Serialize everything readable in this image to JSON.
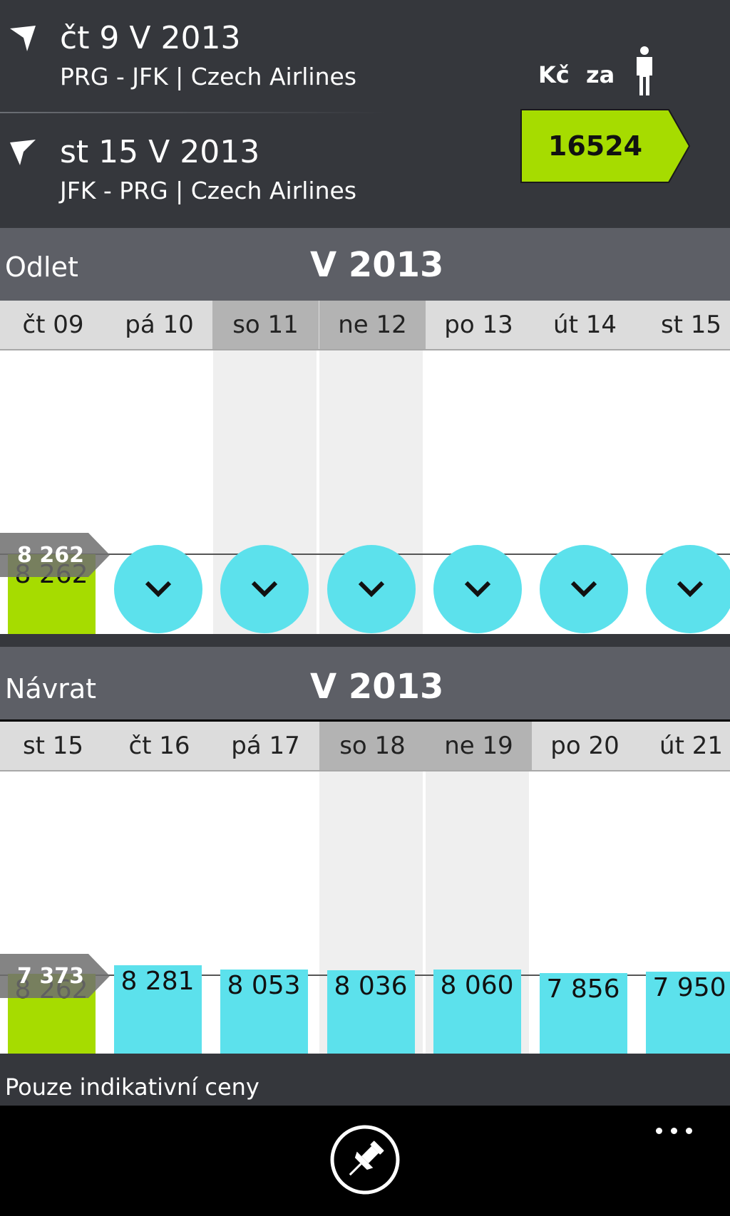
{
  "header": {
    "outbound": {
      "date": "čt 9 V 2013",
      "route": "PRG - JFK | Czech Airlines"
    },
    "return": {
      "date": "st 15 V 2013",
      "route": "JFK - PRG | Czech Airlines"
    },
    "currency": "Kč",
    "per": "za",
    "person_icon": "person-icon",
    "price": "16524",
    "price_color": "#a6dc00"
  },
  "departure": {
    "label": "Odlet",
    "month": "V 2013",
    "days": [
      "čt 09",
      "pá 10",
      "so 11",
      "ne 12",
      "po 13",
      "út 14",
      "st 15"
    ],
    "weekend": [
      false,
      false,
      true,
      true,
      false,
      false,
      false
    ],
    "selected_price": "8 262",
    "marker_price": "8 262",
    "expand_icon": "chevron-down-icon"
  },
  "return": {
    "label": "Návrat",
    "month": "V 2013",
    "days": [
      "st 15",
      "čt 16",
      "pá 17",
      "so 18",
      "ne 19",
      "po 20",
      "út 21"
    ],
    "weekend": [
      false,
      false,
      false,
      true,
      true,
      false,
      false
    ],
    "prices": [
      "8 262",
      "8 281",
      "8 053",
      "8 036",
      "8 060",
      "7 856",
      "7 950"
    ],
    "marker_price": "7 373"
  },
  "note": "Pouze indikativní ceny",
  "appbar": {
    "pin_icon": "pin-icon",
    "more_icon": "more-icon"
  },
  "colors": {
    "accent_green": "#a6dc00",
    "accent_cyan": "#5ce1ec",
    "header_bg": "#35373c",
    "section_bg": "#5d5f66"
  }
}
